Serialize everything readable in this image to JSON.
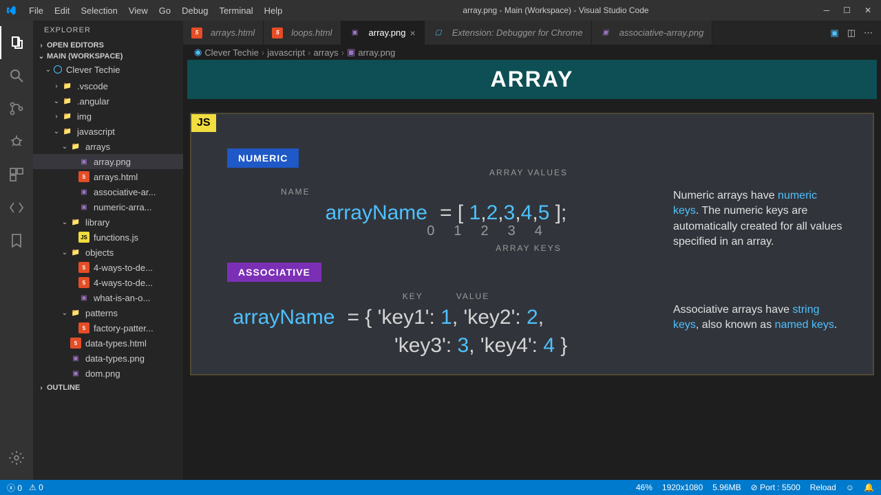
{
  "window": {
    "title": "array.png - Main (Workspace) - Visual Studio Code"
  },
  "menu": [
    "File",
    "Edit",
    "Selection",
    "View",
    "Go",
    "Debug",
    "Terminal",
    "Help"
  ],
  "sidebar": {
    "title": "EXPLORER",
    "sections": {
      "openEditors": "OPEN EDITORS",
      "workspace": "MAIN (WORKSPACE)",
      "outline": "OUTLINE"
    },
    "root": "Clever Techie",
    "tree": [
      {
        "indent": 1,
        "chev": ">",
        "icon": "folder-blue",
        "label": ".vscode"
      },
      {
        "indent": 1,
        "chev": "v",
        "icon": "folder",
        "label": ".angular"
      },
      {
        "indent": 1,
        "chev": ">",
        "icon": "folder-img",
        "label": "img"
      },
      {
        "indent": 1,
        "chev": "v",
        "icon": "folder-y",
        "label": "javascript"
      },
      {
        "indent": 2,
        "chev": "v",
        "icon": "folder",
        "label": "arrays"
      },
      {
        "indent": 3,
        "chev": "",
        "icon": "img",
        "label": "array.png",
        "active": true
      },
      {
        "indent": 3,
        "chev": "",
        "icon": "html",
        "label": "arrays.html"
      },
      {
        "indent": 3,
        "chev": "",
        "icon": "img",
        "label": "associative-ar..."
      },
      {
        "indent": 3,
        "chev": "",
        "icon": "img",
        "label": "numeric-arra..."
      },
      {
        "indent": 2,
        "chev": "v",
        "icon": "folder-y",
        "label": "library"
      },
      {
        "indent": 3,
        "chev": "",
        "icon": "js",
        "label": "functions.js"
      },
      {
        "indent": 2,
        "chev": "v",
        "icon": "folder",
        "label": "objects"
      },
      {
        "indent": 3,
        "chev": "",
        "icon": "html",
        "label": "4-ways-to-de..."
      },
      {
        "indent": 3,
        "chev": "",
        "icon": "html",
        "label": "4-ways-to-de..."
      },
      {
        "indent": 3,
        "chev": "",
        "icon": "img",
        "label": "what-is-an-o..."
      },
      {
        "indent": 2,
        "chev": "v",
        "icon": "folder",
        "label": "patterns"
      },
      {
        "indent": 3,
        "chev": "",
        "icon": "html",
        "label": "factory-patter..."
      },
      {
        "indent": 2,
        "chev": "",
        "icon": "html",
        "label": "data-types.html"
      },
      {
        "indent": 2,
        "chev": "",
        "icon": "img",
        "label": "data-types.png"
      },
      {
        "indent": 2,
        "chev": "",
        "icon": "img",
        "label": "dom.png"
      }
    ]
  },
  "tabs": [
    {
      "icon": "html",
      "label": "arrays.html"
    },
    {
      "icon": "html",
      "label": "loops.html"
    },
    {
      "icon": "img",
      "label": "array.png",
      "active": true,
      "close": true
    },
    {
      "icon": "ext",
      "label": "Extension: Debugger for Chrome"
    },
    {
      "icon": "img",
      "label": "associative-array.png"
    }
  ],
  "breadcrumbs": [
    "Clever Techie",
    "javascript",
    "arrays",
    "array.png"
  ],
  "slide": {
    "banner": "ARRAY",
    "js": "JS",
    "numeric": {
      "label": "NUMERIC",
      "nameCaption": "NAME",
      "valuesCaption": "ARRAY VALUES",
      "keysCaption": "ARRAY KEYS",
      "var": "arrayName",
      "values": [
        "1",
        "2",
        "3",
        "4",
        "5"
      ],
      "keys": [
        "0",
        "1",
        "2",
        "3",
        "4"
      ],
      "descPre": "Numeric arrays have ",
      "descHl": "numeric keys",
      "descPost": ". The numeric keys are automatically created for all values specified in an array."
    },
    "assoc": {
      "label": "ASSOCIATIVE",
      "keyCaption": "KEY",
      "valueCaption": "VALUE",
      "var": "arrayName",
      "line1": "{ 'key1': 1, 'key2': 2,",
      "line2": "'key3': 3, 'key4': 4 }",
      "descPre": "Associative arrays have ",
      "descHl": "string keys",
      "descMid": ", also known as ",
      "descHl2": "named keys",
      "descPost": "."
    }
  },
  "status": {
    "errors": "0",
    "warnings": "0",
    "zoom": "46%",
    "dims": "1920x1080",
    "size": "5.96MB",
    "port": "Port : 5500",
    "reload": "Reload"
  }
}
